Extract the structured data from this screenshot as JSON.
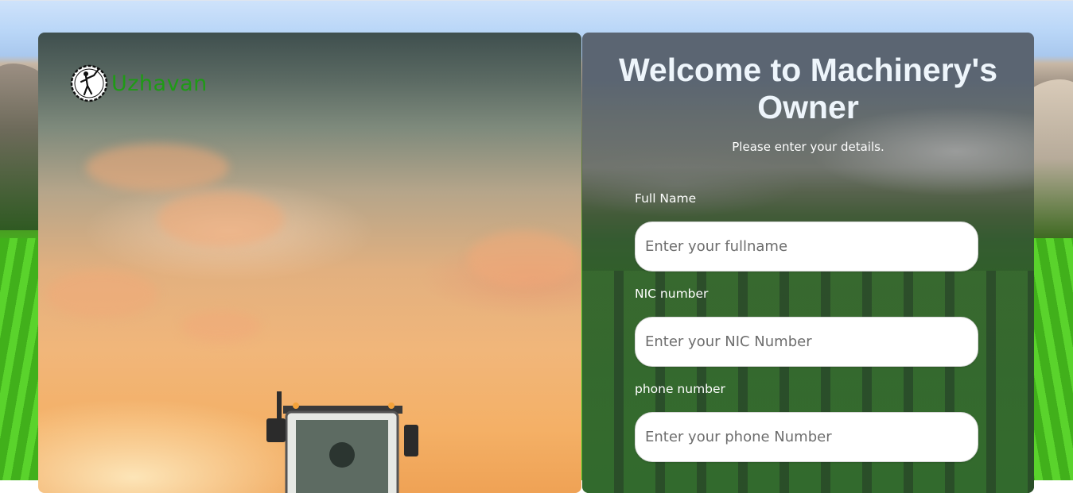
{
  "brand": {
    "name": "Uzhavan",
    "color": "#1f9a16"
  },
  "form": {
    "title": "Welcome to Machinery's Owner",
    "subtitle": "Please enter your details.",
    "fields": [
      {
        "label": "Full Name",
        "placeholder": "Enter your fullname",
        "value": ""
      },
      {
        "label": "NIC number",
        "placeholder": "Enter your NIC Number",
        "value": ""
      },
      {
        "label": "phone number",
        "placeholder": "Enter your phone Number",
        "value": ""
      }
    ]
  },
  "icons": {
    "logo": "golfer-logo-icon",
    "hero": "tractor-illustration"
  }
}
